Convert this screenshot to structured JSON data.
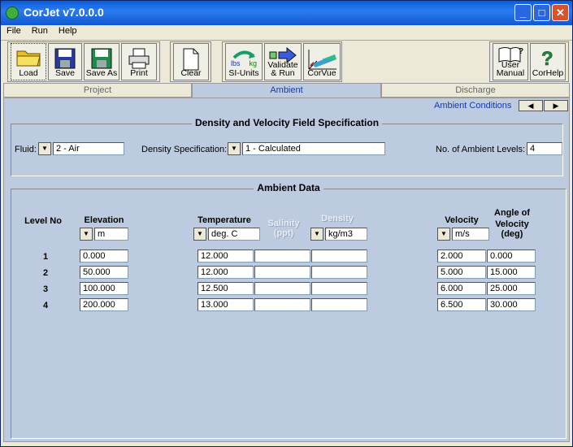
{
  "window": {
    "title": "CorJet v7.0.0.0"
  },
  "menu": [
    "File",
    "Run",
    "Help"
  ],
  "toolbar": {
    "load": "Load",
    "save": "Save",
    "save_as": "Save As",
    "print": "Print",
    "clear": "Clear",
    "si_units": "SI-Units",
    "si_lbs": "lbs",
    "si_kg": "kg",
    "validate_run": [
      "Validate",
      "& Run"
    ],
    "corvue": "CorVue",
    "user_manual": [
      "User",
      "Manual"
    ],
    "corhelp": "CorHelp"
  },
  "tabs": [
    "Project",
    "Ambient",
    "Discharge"
  ],
  "active_tab": "Ambient",
  "ambient_conditions": "Ambient Conditions",
  "density_field": {
    "title": "Density and Velocity Field Specification",
    "fluid_label": "Fluid:",
    "fluid_value": "2 - Air",
    "density_spec_label": "Density Specification:",
    "density_spec_value": "1 - Calculated",
    "levels_label": "No. of Ambient Levels:",
    "levels_value": "4"
  },
  "ambient_data": {
    "title": "Ambient Data",
    "headers": {
      "level_no": "Level No",
      "elevation": "Elevation",
      "temperature": "Temperature",
      "salinity": [
        "Salinity",
        "(ppt)"
      ],
      "density": "Density",
      "velocity": "Velocity",
      "angle": [
        "Angle of",
        "Velocity",
        "(deg)"
      ]
    },
    "units": {
      "elevation": "m",
      "temperature": "deg. C",
      "density": "kg/m3",
      "velocity": "m/s"
    },
    "rows": [
      {
        "level": "1",
        "elevation": "0.000",
        "temperature": "12.000",
        "salinity": "",
        "density": "",
        "velocity": "2.000",
        "angle": "0.000"
      },
      {
        "level": "2",
        "elevation": "50.000",
        "temperature": "12.000",
        "salinity": "",
        "density": "",
        "velocity": "5.000",
        "angle": "15.000"
      },
      {
        "level": "3",
        "elevation": "100.000",
        "temperature": "12.500",
        "salinity": "",
        "density": "",
        "velocity": "6.000",
        "angle": "25.000"
      },
      {
        "level": "4",
        "elevation": "200.000",
        "temperature": "13.000",
        "salinity": "",
        "density": "",
        "velocity": "6.500",
        "angle": "30.000"
      }
    ]
  }
}
